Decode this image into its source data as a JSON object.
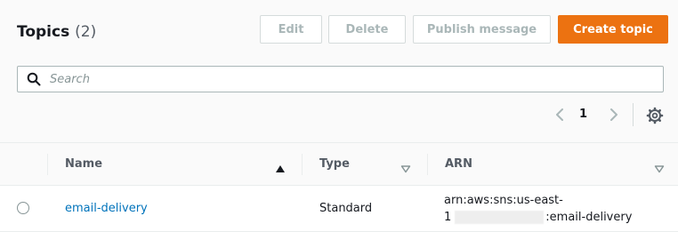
{
  "header": {
    "title": "Topics",
    "count": "(2)"
  },
  "actions": {
    "edit": "Edit",
    "delete": "Delete",
    "publish": "Publish message",
    "create": "Create topic"
  },
  "search": {
    "placeholder": "Search",
    "value": ""
  },
  "pagination": {
    "current_page": "1"
  },
  "table": {
    "columns": [
      "Name",
      "Type",
      "ARN"
    ],
    "sort_column": "Name",
    "sort_direction": "ascending",
    "rows": [
      {
        "name": "email-delivery",
        "type": "Standard",
        "arn_line1": "arn:aws:sns:us-east-",
        "arn_line2_prefix": "1",
        "arn_line2_suffix": ":email-delivery"
      }
    ]
  },
  "colors": {
    "accent_primary": "#ec7211",
    "link": "#0073bb",
    "disabled_text": "#aab7b8"
  },
  "icons": {
    "search": "search-icon",
    "prev": "chevron-left-icon",
    "next": "chevron-right-icon",
    "settings": "gear-icon",
    "sort_asc": "caret-up-icon",
    "sort_unsorted": "caret-down-outline-icon"
  }
}
